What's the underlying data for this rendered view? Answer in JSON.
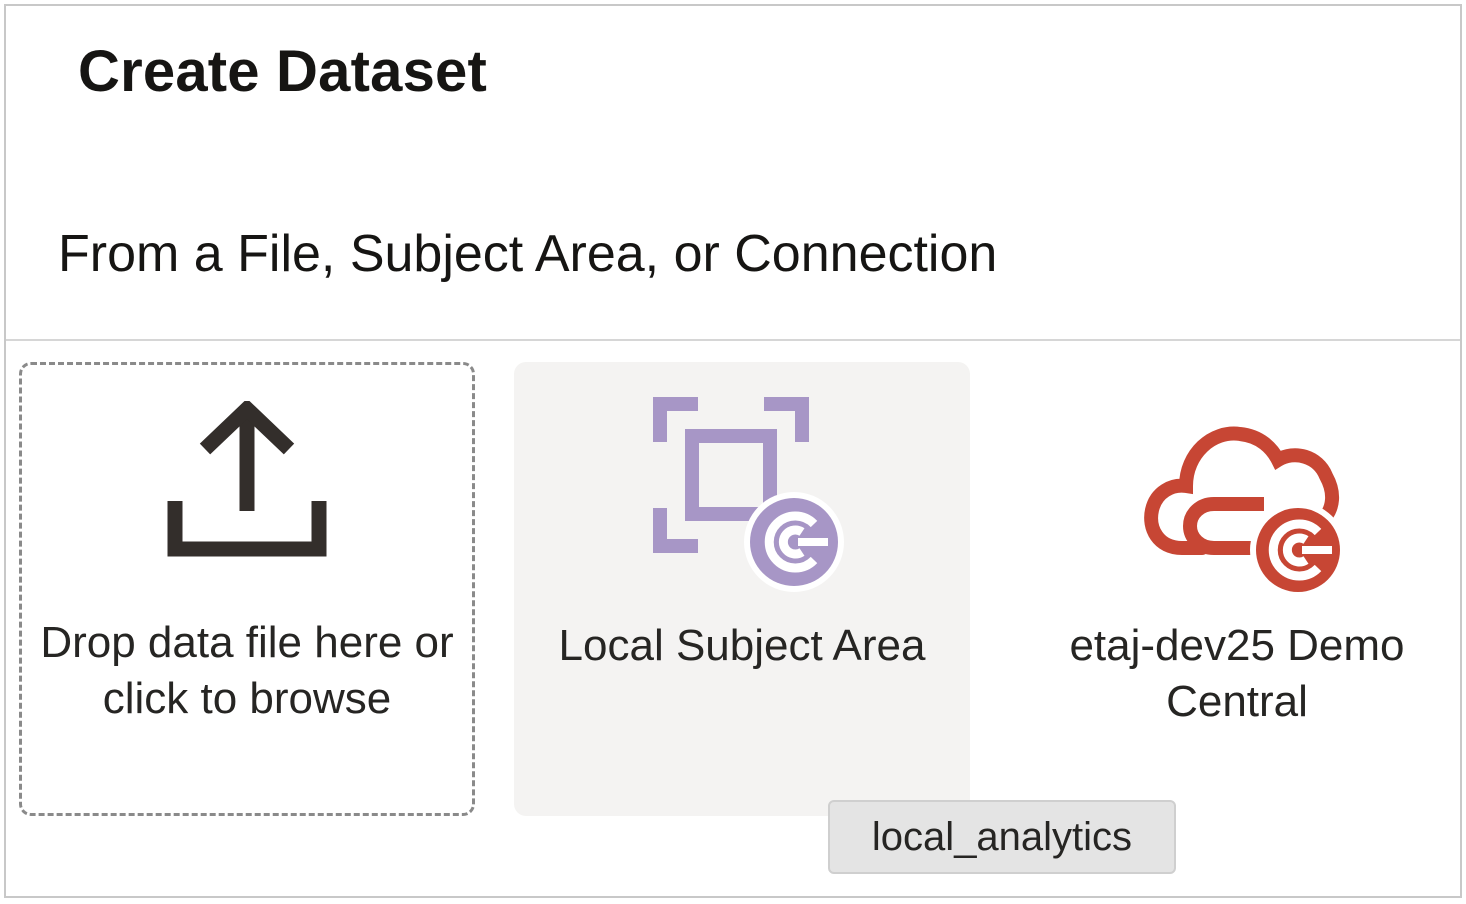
{
  "dialog": {
    "title": "Create Dataset",
    "subtitle": "From a File, Subject Area, or Connection"
  },
  "tiles": [
    {
      "label": "Drop data file here or click to browse",
      "icon": "upload-icon"
    },
    {
      "label": "Local Subject Area",
      "icon": "subject-area-icon"
    },
    {
      "label": "etaj-dev25 Demo Central",
      "icon": "cloud-connection-icon"
    }
  ],
  "tooltip": {
    "text": "local_analytics"
  },
  "colors": {
    "upload_icon": "#332e2b",
    "subject_area_icon": "#a796c6",
    "connection_icon": "#c74634",
    "hover_tile_bg": "#f4f3f2"
  }
}
